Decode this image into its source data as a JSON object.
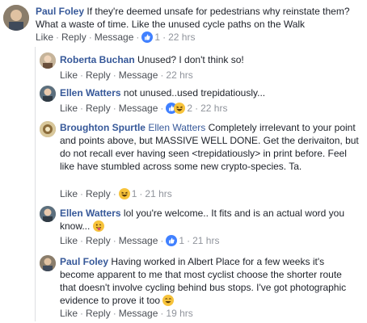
{
  "comments": [
    {
      "author": "Paul Foley",
      "text_before_mention": "",
      "mention": "",
      "text": " If they're deemed unsafe for pedestrians why reinstate them? What a waste of time. Like the unused cycle paths on the Walk",
      "like": "Like",
      "reply": "Reply",
      "message": "Message",
      "reactions": "1",
      "time": "22 hrs"
    },
    {
      "author": "Roberta Buchan",
      "mention": "",
      "text": " Unused? I don't think so!",
      "like": "Like",
      "reply": "Reply",
      "message": "Message",
      "reactions": "",
      "time": "22 hrs"
    },
    {
      "author": "Ellen Watters",
      "mention": "",
      "text": " not unused..used trepidatiously...",
      "like": "Like",
      "reply": "Reply",
      "message": "Message",
      "reactions": "2",
      "time": "22 hrs"
    },
    {
      "author": "Broughton Spurtle",
      "mention": "Ellen Watters",
      "text": " Completely irrelevant to your point and points above, but MASSIVE WELL DONE. Get the derivaiton, but do not recall ever having seen <trepidatiously> in print before. Feel like have stumbled across some new crypto-species. Ta.",
      "like": "Like",
      "reply": "Reply",
      "message": "",
      "reactions": "1",
      "time": "21 hrs"
    },
    {
      "author": "Ellen Watters",
      "mention": "",
      "text": " lol you're welcome.. It fits and is an actual word you know...",
      "like": "Like",
      "reply": "Reply",
      "message": "Message",
      "reactions": "1",
      "time": "21 hrs"
    },
    {
      "author": "Paul Foley",
      "mention": "",
      "text": " Having worked in Albert Place for a few weeks it's become apparent to me that most cyclist choose the shorter route that doesn't involve cycling behind bus stops. I've got photographic evidence to prove it too",
      "like": "Like",
      "reply": "Reply",
      "message": "Message",
      "reactions": "",
      "time": "19 hrs"
    }
  ],
  "separator": "·",
  "colors": {
    "link": "#365899",
    "meta": "#90949c",
    "like_blue": "#4080ff",
    "emoji_yellow": "#f7c33b"
  }
}
